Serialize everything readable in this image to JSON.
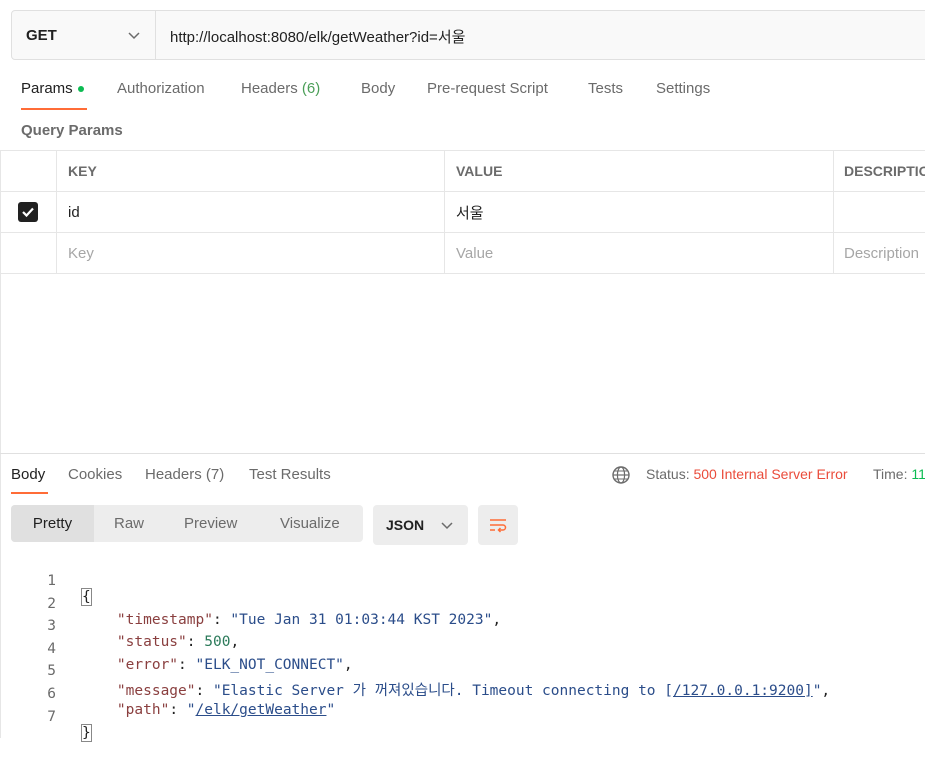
{
  "request": {
    "method": "GET",
    "url": "http://localhost:8080/elk/getWeather?id=서울"
  },
  "request_tabs": {
    "params": "Params",
    "authorization": "Authorization",
    "headers": "Headers",
    "headers_count": "(6)",
    "body": "Body",
    "pre_request": "Pre-request Script",
    "tests": "Tests",
    "settings": "Settings"
  },
  "query_params": {
    "label": "Query Params",
    "columns": {
      "key": "KEY",
      "value": "VALUE",
      "description": "DESCRIPTIO"
    },
    "rows": [
      {
        "key": "id",
        "value": "서울",
        "description": "",
        "checked": true
      }
    ],
    "placeholders": {
      "key": "Key",
      "value": "Value",
      "description": "Description"
    }
  },
  "response_tabs": {
    "body": "Body",
    "cookies": "Cookies",
    "headers": "Headers",
    "headers_count": "(7)",
    "test_results": "Test Results"
  },
  "response_status": {
    "status_label": "Status:",
    "status_value": "500 Internal Server Error",
    "time_label": "Time:",
    "time_value": "11"
  },
  "format_tabs": {
    "pretty": "Pretty",
    "raw": "Raw",
    "preview": "Preview",
    "visualize": "Visualize",
    "language": "JSON"
  },
  "response_body": {
    "line_numbers": [
      "1",
      "2",
      "3",
      "4",
      "5",
      "6",
      "7"
    ],
    "open_brace": "{",
    "close_brace": "}",
    "timestamp_key": "\"timestamp\"",
    "timestamp_value": "\"Tue Jan 31 01:03:44 KST 2023\"",
    "status_key": "\"status\"",
    "status_value": "500",
    "error_key": "\"error\"",
    "error_value": "\"ELK_NOT_CONNECT\"",
    "message_key": "\"message\"",
    "message_value_prefix": "\"Elastic Server 가 꺼져있습니다. Timeout connecting to [",
    "message_value_link": "/127.0.0.1:9200]",
    "message_value_suffix": "\"",
    "path_key": "\"path\"",
    "path_value_open": "\"",
    "path_value_link": "/elk/getWeather",
    "path_value_close": "\""
  },
  "colors": {
    "accent": "#ff6c37",
    "active_dot": "#0cbb52",
    "status_error": "#ea4c3b"
  }
}
